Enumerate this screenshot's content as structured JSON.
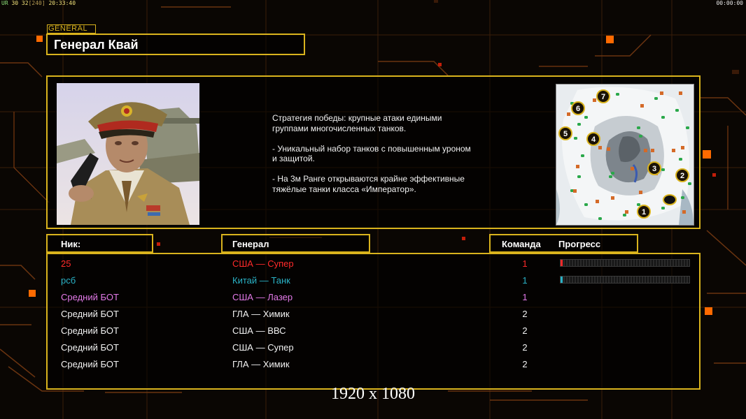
{
  "hud": {
    "left_ur": "UR",
    "left_nums": "30 32",
    "left_bracket": "[240]",
    "left_time": "20:33:40",
    "right_time": "00:00:00"
  },
  "general": {
    "tag": "GENERAL",
    "name": "Генерал Квай",
    "description": "Стратегия победы: крупные атаки едиными\n группами многочисленных танков.\n\n- Уникальный набор танков с повышенным уроном\n и защитой.\n\n- На 3м Ранге открываются крайне эффективные\n тяжёлые танки класса «Император»."
  },
  "minimap": {
    "markers": [
      {
        "label": "1"
      },
      {
        "label": "2"
      },
      {
        "label": "3"
      },
      {
        "label": "4"
      },
      {
        "label": "5"
      },
      {
        "label": "6"
      },
      {
        "label": "7"
      }
    ]
  },
  "headers": {
    "nick": "Ник:",
    "general": "Генерал",
    "team": "Команда",
    "progress": "Прогресс"
  },
  "players": [
    {
      "nick": "25",
      "general": "США — Супер",
      "team": "1",
      "color": "#ff2a2a",
      "progress": 0.01,
      "show_progress": true
    },
    {
      "nick": "рсб",
      "general": "Китай — Танк",
      "team": "1",
      "color": "#2ab3c7",
      "progress": 0.01,
      "show_progress": true
    },
    {
      "nick": "Средний БОТ",
      "general": "США — Лазер",
      "team": "1",
      "color": "#e37ae8",
      "progress": 0,
      "show_progress": false
    },
    {
      "nick": "Средний БОТ",
      "general": "ГЛА — Химик",
      "team": "2",
      "color": "#f2f2f2",
      "progress": 0,
      "show_progress": false
    },
    {
      "nick": "Средний БОТ",
      "general": "США — ВВС",
      "team": "2",
      "color": "#f2f2f2",
      "progress": 0,
      "show_progress": false
    },
    {
      "nick": "Средний БОТ",
      "general": "США — Супер",
      "team": "2",
      "color": "#f2f2f2",
      "progress": 0,
      "show_progress": false
    },
    {
      "nick": "Средний БОТ",
      "general": "ГЛА — Химик",
      "team": "2",
      "color": "#f2f2f2",
      "progress": 0,
      "show_progress": false
    }
  ],
  "resolution_label": "1920 x 1080",
  "colors": {
    "accent": "#d9b31d",
    "background": "#0a0603"
  }
}
